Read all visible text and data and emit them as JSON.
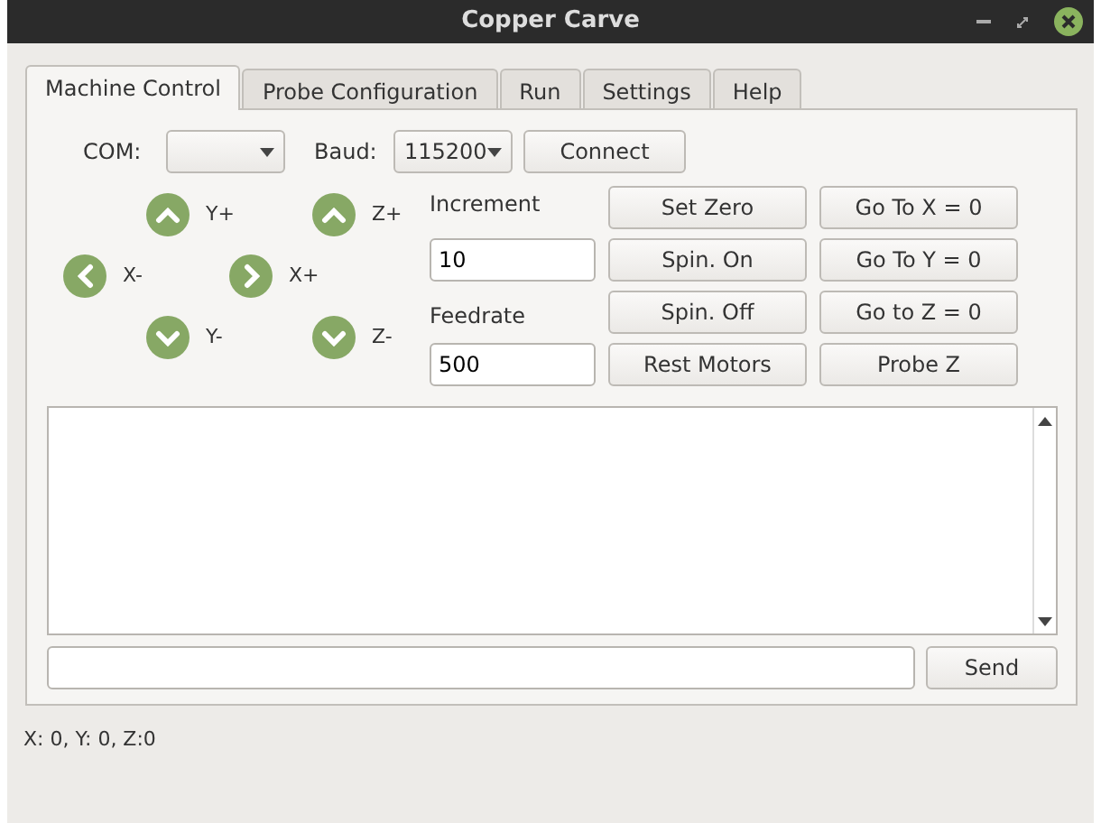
{
  "window": {
    "title": "Copper Carve"
  },
  "tabs": [
    {
      "label": "Machine Control",
      "selected": true
    },
    {
      "label": "Probe Configuration",
      "selected": false
    },
    {
      "label": "Run",
      "selected": false
    },
    {
      "label": "Settings",
      "selected": false
    },
    {
      "label": "Help",
      "selected": false
    }
  ],
  "connection": {
    "com_label": "COM:",
    "baud_label": "Baud:",
    "baud_value": "115200",
    "connect_button": "Connect"
  },
  "jog": [
    {
      "kind": "up",
      "label": "Y+"
    },
    {
      "kind": "up",
      "label": "Z+"
    },
    {
      "kind": "left",
      "label": "X-"
    },
    {
      "kind": "right",
      "label": "X+"
    },
    {
      "kind": "down",
      "label": "Y-"
    },
    {
      "kind": "down",
      "label": "Z-"
    }
  ],
  "increment": {
    "label": "Increment",
    "value": "10"
  },
  "feedrate": {
    "label": "Feedrate",
    "value": "500"
  },
  "actions": [
    "Set Zero",
    "Go To X = 0",
    "Spin. On",
    "Go To Y = 0",
    "Spin. Off",
    "Go to Z = 0",
    "Rest Motors",
    "Probe Z"
  ],
  "command": {
    "send_button": "Send"
  },
  "status_bar": "X: 0, Y: 0, Z:0"
}
